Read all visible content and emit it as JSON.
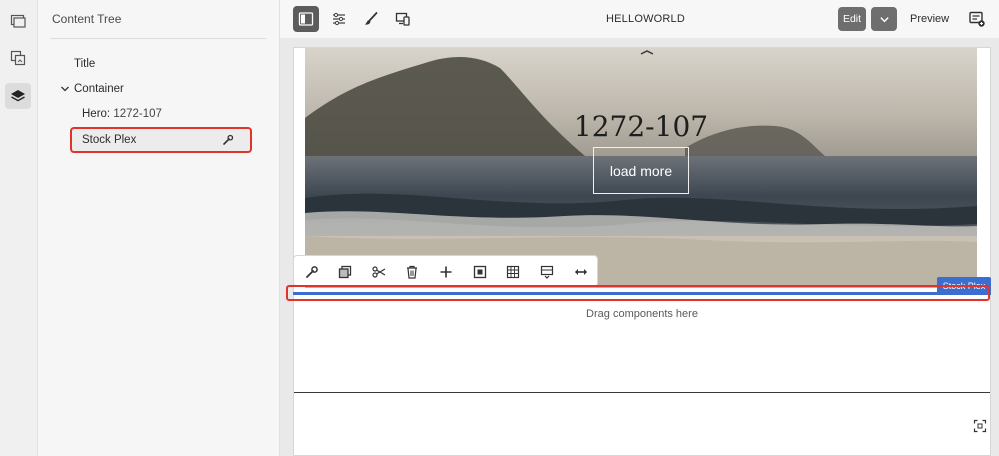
{
  "rail": {
    "items": [
      {
        "name": "pages-icon"
      },
      {
        "name": "assets-icon"
      },
      {
        "name": "layers-icon",
        "active": true
      }
    ]
  },
  "panel": {
    "title": "Content Tree",
    "items": [
      {
        "label": "Title"
      },
      {
        "label": "Container",
        "expanded": true
      },
      {
        "label_prefix": "Hero:",
        "label_value": "1272-107"
      },
      {
        "label": "Stock Plex",
        "selected": true
      }
    ]
  },
  "topbar": {
    "title": "HELLOWORLD",
    "edit_label": "Edit",
    "preview_label": "Preview"
  },
  "hero": {
    "title": "1272-107",
    "cta": "load more"
  },
  "component": {
    "tag": "Stock Plex",
    "drop_hint": "Drag components here"
  },
  "colors": {
    "accent": "#3c6ecf",
    "highlight": "#e0342b"
  }
}
